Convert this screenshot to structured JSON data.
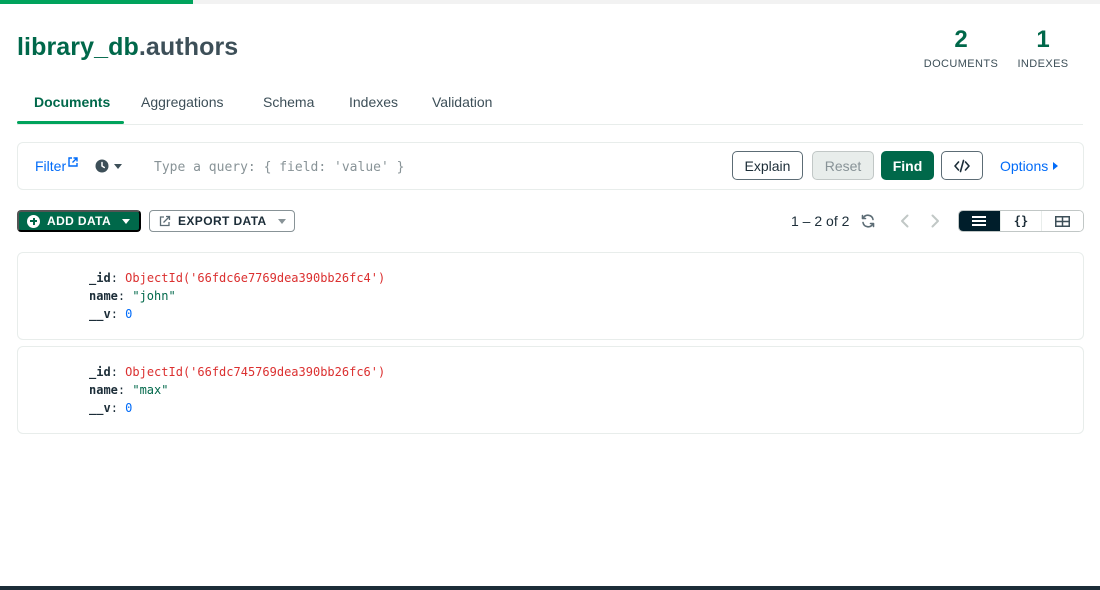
{
  "namespace": {
    "db": "library_db",
    "separator": ".",
    "collection": "authors"
  },
  "stats": {
    "documents": {
      "value": "2",
      "label": "DOCUMENTS"
    },
    "indexes": {
      "value": "1",
      "label": "INDEXES"
    }
  },
  "tabs": [
    {
      "label": "Documents",
      "active": true
    },
    {
      "label": "Aggregations",
      "active": false
    },
    {
      "label": "Schema",
      "active": false
    },
    {
      "label": "Indexes",
      "active": false
    },
    {
      "label": "Validation",
      "active": false
    }
  ],
  "query_bar": {
    "filter_label": "Filter",
    "placeholder": "Type a query: { field: 'value' }",
    "value": "",
    "explain_label": "Explain",
    "reset_label": "Reset",
    "find_label": "Find",
    "options_label": "Options"
  },
  "toolbar": {
    "add_data_label": "ADD DATA",
    "export_data_label": "EXPORT DATA",
    "pagination": "1 – 2 of 2"
  },
  "view_toggle": {
    "active": "list",
    "json_glyph": "{}"
  },
  "documents": [
    {
      "fields": [
        {
          "key": "_id",
          "value": "ObjectId('66fdc6e7769dea390bb26fc4')",
          "kind": "oid"
        },
        {
          "key": "name",
          "value": "\"john\"",
          "kind": "str"
        },
        {
          "key": "__v",
          "value": "0",
          "kind": "num"
        }
      ]
    },
    {
      "fields": [
        {
          "key": "_id",
          "value": "ObjectId('66fdc745769dea390bb26fc6')",
          "kind": "oid"
        },
        {
          "key": "name",
          "value": "\"max\"",
          "kind": "str"
        },
        {
          "key": "__v",
          "value": "0",
          "kind": "num"
        }
      ]
    }
  ],
  "colors": {
    "brand_green": "#00684a",
    "accent_green": "#00a35c",
    "link_blue": "#016bf8",
    "oid_red": "#db3030"
  },
  "icons": [
    "external-link-icon",
    "clock-icon",
    "chevron-down-icon",
    "code-icon",
    "triangle-right-icon",
    "plus-circle-icon",
    "export-icon",
    "refresh-icon",
    "chevron-left-icon",
    "chevron-right-icon",
    "list-view-icon",
    "json-view-icon",
    "table-view-icon"
  ]
}
